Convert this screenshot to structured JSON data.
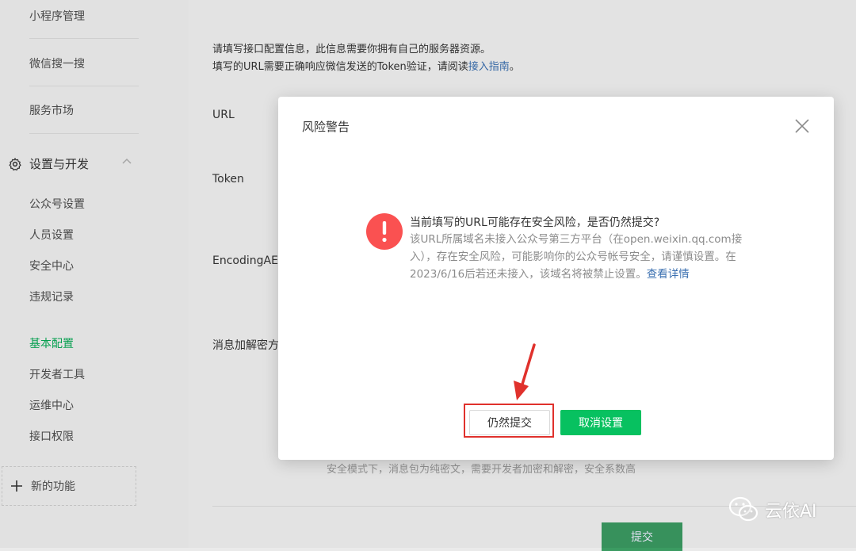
{
  "sidebar": {
    "top_items": [
      "小程序管理",
      "微信搜一搜",
      "服务市场"
    ],
    "section_title": "设置与开发",
    "section_icon": "gear-icon",
    "items": [
      "公众号设置",
      "人员设置",
      "安全中心",
      "违规记录",
      "基本配置",
      "开发者工具",
      "运维中心",
      "接口权限"
    ],
    "active_item": "基本配置",
    "new_feature": "新的功能"
  },
  "main": {
    "info_line1": "请填写接口配置信息，此信息需要你拥有自己的服务器资源。",
    "info_line2_prefix": "填写的URL需要正确响应微信发送的Token验证，请阅读",
    "info_line2_link": "接入指南",
    "info_line2_suffix": "。",
    "labels": [
      "URL",
      "Token",
      "EncodingAES",
      "消息加解密方"
    ],
    "safe_mode_hint": "安全模式下，消息包为纯密文，需要开发者加密和解密，安全系数高",
    "submit_label": "提交"
  },
  "modal": {
    "title": "风险警告",
    "message_title": "当前填写的URL可能存在安全风险，是否仍然提交?",
    "message_body": "该URL所属域名未接入公众号第三方平台（在open.weixin.qq.com接入），存在安全风险，可能影响你的公众号帐号安全，请谨慎设置。在2023/6/16后若还未接入，该域名将被禁止设置。",
    "message_link": "查看详情",
    "confirm_label": "仍然提交",
    "cancel_label": "取消设置"
  },
  "watermark": {
    "text": "云依AI"
  },
  "colors": {
    "accent_green": "#07c160",
    "warning_red": "#fa5151",
    "link_blue": "#3a6fb0",
    "highlight_red": "#e0312c"
  }
}
